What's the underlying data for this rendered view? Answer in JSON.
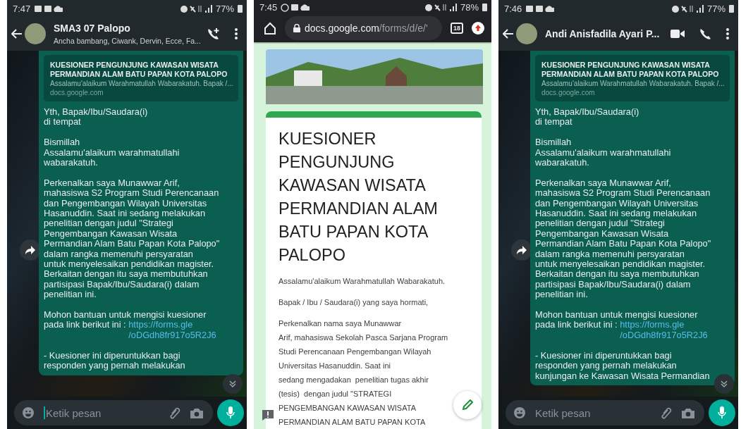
{
  "screens": [
    {
      "kind": "chat",
      "status_bar": {
        "time": "7:47",
        "battery": "77%"
      },
      "header": {
        "title": "SMA3 07 Palopo",
        "subtitle": "Ancha bambang, Ciwank, Dervin, Ecce, Fa...",
        "actions": [
          {
            "kind": "add-call"
          },
          {
            "kind": "menu"
          }
        ]
      },
      "link_preview": {
        "title": "KUESIONER PENGUNJUNG KAWASAN WISATA\nPERMANDIAN ALAM BATU PAPAN KOTA PALOPO",
        "description": "Assalamu'alaikum Warahmatullah Wabarakatuh. Bapak /...",
        "domain": "docs.google.com"
      },
      "paragraphs": [
        {
          "text": "Yth, Bapak/Ibu/Saudara(i)\ndi tempat"
        },
        {
          "text": "Bismillah\nAssalamu'alaikum warahmatullahi\nwabarakatuh."
        },
        {
          "text": "Perkenalkan saya Munawwar Arif,\nmahasiswa S2 Program Studi Perencanaan\ndan Pengembangan Wilayah Universitas\nHasanuddin. Saat ini sedang melakukan\npenelitian dengan judul \"Strategi\nPengembangan Kawasan Wisata\nPermandian Alam Batu Papan Kota Palopo\"\ndalam rangka memenuhi persyaratan\nuntuk menyelesaikan pendidikan magister.\nBerkaitan dengan itu saya membutuhkan\npartisipasi Bapak/Ibu/Saudara(i) dalam\npenelitian ini."
        },
        {
          "text": "Mohon bantuan untuk mengisi kuesioner\npada link berikut ini : ",
          "link": "https://forms.gle\n/oDGdh8fr917o5R2J6"
        },
        {
          "text": "- Kuesioner ini diperuntukkan bagi\nresponden yang pernah melakukan"
        }
      ],
      "composer": {
        "placeholder": "Ketik pesan",
        "focused": true
      }
    },
    {
      "kind": "browser",
      "status_bar": {
        "time": "7:45",
        "battery": "78%"
      },
      "address": {
        "host": "docs.google.com",
        "path": "/forms/d/e/'"
      },
      "tab_count": "18",
      "form": {
        "title": "KUESIONER\nPENGUNJUNG\nKAWASAN WISATA\nPERMANDIAN ALAM\nBATU PAPAN KOTA\nPALOPO",
        "paragraphs": [
          "Assalamu'alaikum Warahmatullah Wabarakatuh.",
          "Bapak / Ibu / Saudara(i) yang saya hormati,",
          "Perkenalkan nama saya Munawwar\nArif, mahasiswa Sekolah Pasca Sarjana Program\nStudi Perencanaan Pengembangan Wilayah\nUniversitas Hasanuddin. Saat ini\nsedang mengadakan  penelitian tugas akhir\n(tesis)  dengan judul \"STRATEGI\nPENGEMBANGAN KAWASAN WISATA\nPERMANDIAN ALAM BATU PAPAN KOTA"
        ]
      }
    },
    {
      "kind": "chat",
      "status_bar": {
        "time": "7:46",
        "battery": "77%"
      },
      "header": {
        "title": "Andi Anisfadila Ayari P...",
        "actions": [
          {
            "kind": "video-call"
          },
          {
            "kind": "call"
          },
          {
            "kind": "menu"
          }
        ]
      },
      "link_preview": {
        "title": "KUESIONER PENGUNJUNG KAWASAN WISATA\nPERMANDIAN ALAM BATU PAPAN KOTA PALOPO",
        "description": "Assalamu'alaikum Warahmatullah Wabarakatuh. Bapak /...",
        "domain": "docs.google.com"
      },
      "paragraphs": [
        {
          "text": "Yth, Bapak/Ibu/Saudara(i)\ndi tempat"
        },
        {
          "text": "Bismillah\nAssalamu'alaikum warahmatullahi\nwabarakatuh."
        },
        {
          "text": "Perkenalkan saya Munawwar Arif,\nmahasiswa S2 Program Studi Perencanaan\ndan Pengembangan Wilayah Universitas\nHasanuddin. Saat ini sedang melakukan\npenelitian dengan judul \"Strategi\nPengembangan Kawasan Wisata\nPermandian Alam Batu Papan Kota Palopo\"\ndalam rangka memenuhi persyaratan\nuntuk menyelesaikan pendidikan magister.\nBerkaitan dengan itu saya membutuhkan\npartisipasi Bapak/Ibu/Saudara(i) dalam\npenelitian ini."
        },
        {
          "text": "Mohon bantuan untuk mengisi kuesioner\npada link berikut ini : ",
          "link": "https://forms.gle\n/oDGdh8fr917o5R2J6"
        },
        {
          "text": "- Kuesioner ini diperuntukkan bagi\nresponden yang pernah melakukan\nkunjungan ke Kawasan Wisata Permandian"
        }
      ],
      "composer": {
        "placeholder": "Ketik pesan",
        "focused": false
      }
    }
  ]
}
